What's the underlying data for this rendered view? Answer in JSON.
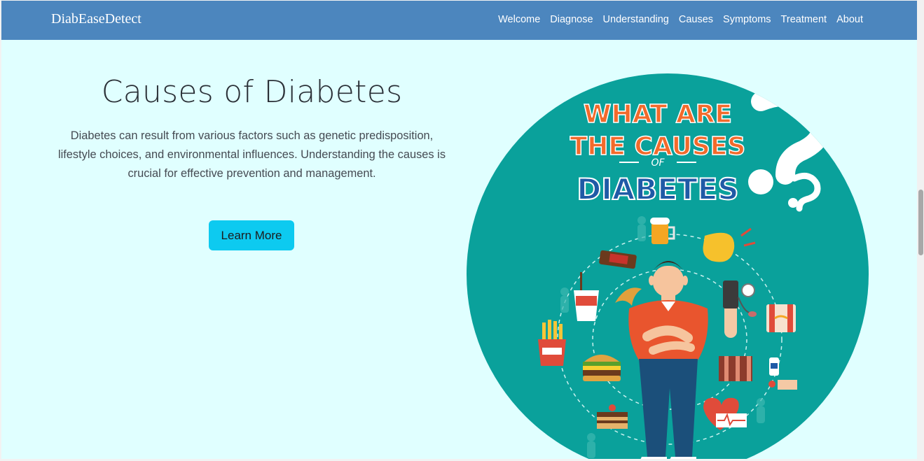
{
  "nav": {
    "brand": "DiabEaseDetect",
    "links": [
      "Welcome",
      "Diagnose",
      "Understanding",
      "Causes",
      "Symptoms",
      "Treatment",
      "About"
    ]
  },
  "hero": {
    "title": "Causes of Diabetes",
    "description": "Diabetes can result from various factors such as genetic predisposition, lifestyle choices, and environmental influences. Understanding the causes is crucial for effective prevention and management.",
    "button_label": "Learn More"
  },
  "image": {
    "line1": "WHAT ARE",
    "line2": "THE CAUSES",
    "line3": "OF",
    "line4": "DIABETES"
  },
  "colors": {
    "navbar": "#4c86be",
    "page_bg": "#e0ffff",
    "button": "#0dcaf0",
    "image_teal": "#0aa19b",
    "headline_orange": "#f26a2b",
    "headline_blue": "#1f5aa6"
  }
}
